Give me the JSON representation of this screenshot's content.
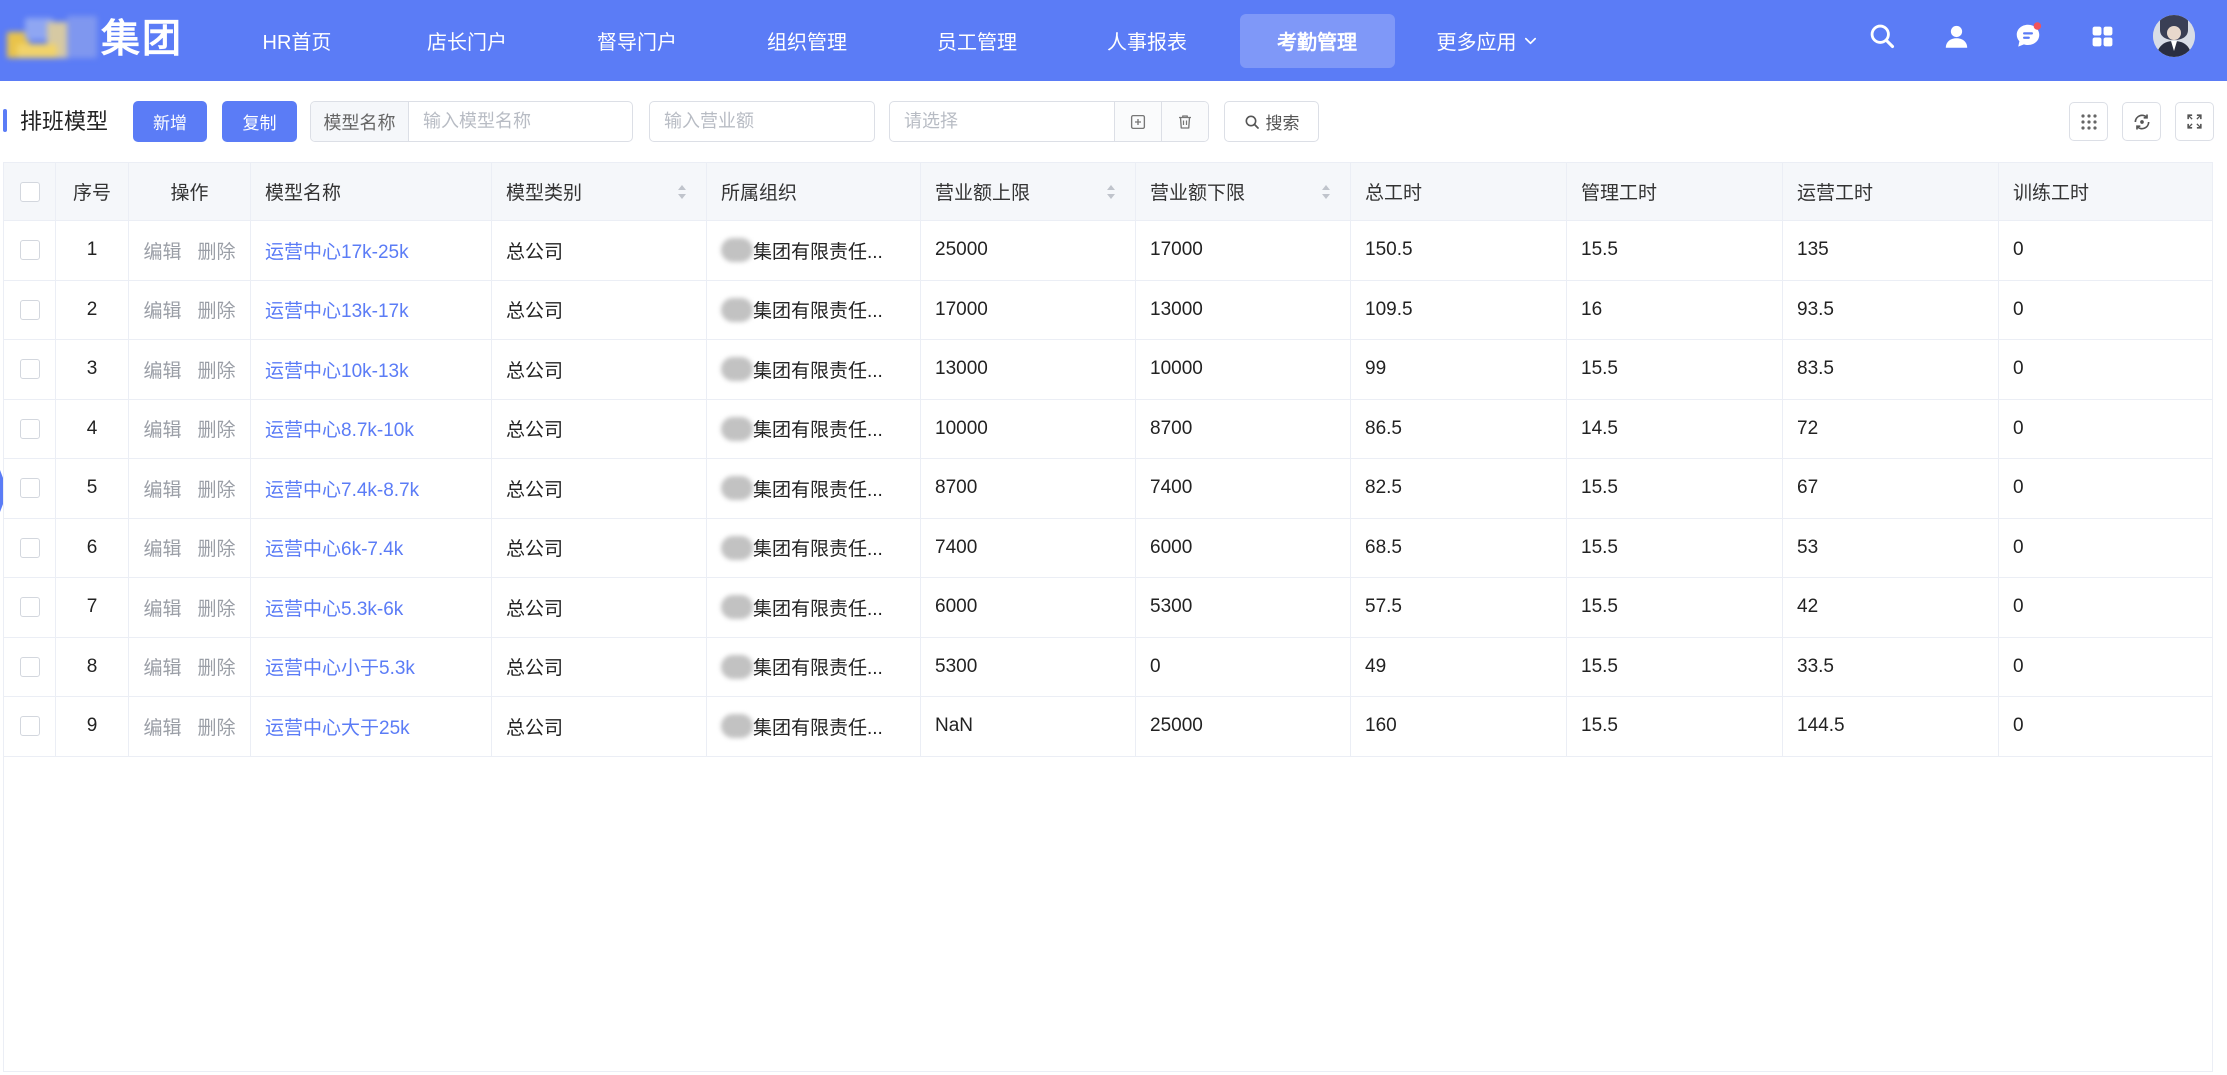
{
  "colors": {
    "primary": "#5b7cf6",
    "link": "#5b7cf6",
    "notification_dot": "#f2545b"
  },
  "brand": {
    "logo_text": "集团"
  },
  "nav": {
    "items": [
      {
        "label": "HR首页",
        "active": false
      },
      {
        "label": "店长门户",
        "active": false
      },
      {
        "label": "督导门户",
        "active": false
      },
      {
        "label": "组织管理",
        "active": false
      },
      {
        "label": "员工管理",
        "active": false
      },
      {
        "label": "人事报表",
        "active": false
      },
      {
        "label": "考勤管理",
        "active": true
      },
      {
        "label": "更多应用",
        "active": false,
        "icon": "chevron-down-icon"
      }
    ],
    "right_icons": [
      "search-icon",
      "user-icon",
      "message-icon",
      "apps-grid-icon",
      "user-avatar"
    ],
    "has_unread_messages": true
  },
  "toolbar": {
    "title": "排班模型",
    "add_label": "新增",
    "copy_label": "复制",
    "model_name": {
      "label": "模型名称",
      "placeholder": "输入模型名称"
    },
    "revenue": {
      "placeholder": "输入营业额"
    },
    "selector": {
      "placeholder": "请选择",
      "icons": [
        "plus-square-icon",
        "trash-icon"
      ]
    },
    "search_label": "搜索",
    "right_icons": [
      "column-settings-icon",
      "refresh-icon",
      "fullscreen-icon"
    ]
  },
  "table": {
    "columns": [
      {
        "label": "序号",
        "sortable": false
      },
      {
        "label": "操作",
        "sortable": false
      },
      {
        "label": "模型名称",
        "sortable": false
      },
      {
        "label": "模型类别",
        "sortable": true
      },
      {
        "label": "所属组织",
        "sortable": false
      },
      {
        "label": "营业额上限",
        "sortable": true
      },
      {
        "label": "营业额下限",
        "sortable": true
      },
      {
        "label": "总工时",
        "sortable": false
      },
      {
        "label": "管理工时",
        "sortable": false
      },
      {
        "label": "运营工时",
        "sortable": false
      },
      {
        "label": "训练工时",
        "sortable": false
      }
    ],
    "actions": {
      "edit": "编辑",
      "delete": "删除"
    },
    "rows": [
      {
        "index": 1,
        "name": "运营中心17k-25k",
        "category": "总公司",
        "org": "集团有限责任...",
        "revenue_max": 25000,
        "revenue_min": 17000,
        "total_hours": 150.5,
        "management_hours": 15.5,
        "operation_hours": 135,
        "training_hours": 0
      },
      {
        "index": 2,
        "name": "运营中心13k-17k",
        "category": "总公司",
        "org": "集团有限责任...",
        "revenue_max": 17000,
        "revenue_min": 13000,
        "total_hours": 109.5,
        "management_hours": 16,
        "operation_hours": 93.5,
        "training_hours": 0
      },
      {
        "index": 3,
        "name": "运营中心10k-13k",
        "category": "总公司",
        "org": "集团有限责任...",
        "revenue_max": 13000,
        "revenue_min": 10000,
        "total_hours": 99,
        "management_hours": 15.5,
        "operation_hours": 83.5,
        "training_hours": 0
      },
      {
        "index": 4,
        "name": "运营中心8.7k-10k",
        "category": "总公司",
        "org": "集团有限责任...",
        "revenue_max": 10000,
        "revenue_min": 8700,
        "total_hours": 86.5,
        "management_hours": 14.5,
        "operation_hours": 72,
        "training_hours": 0
      },
      {
        "index": 5,
        "name": "运营中心7.4k-8.7k",
        "category": "总公司",
        "org": "集团有限责任...",
        "revenue_max": 8700,
        "revenue_min": 7400,
        "total_hours": 82.5,
        "management_hours": 15.5,
        "operation_hours": 67,
        "training_hours": 0
      },
      {
        "index": 6,
        "name": "运营中心6k-7.4k",
        "category": "总公司",
        "org": "集团有限责任...",
        "revenue_max": 7400,
        "revenue_min": 6000,
        "total_hours": 68.5,
        "management_hours": 15.5,
        "operation_hours": 53,
        "training_hours": 0
      },
      {
        "index": 7,
        "name": "运营中心5.3k-6k",
        "category": "总公司",
        "org": "集团有限责任...",
        "revenue_max": 6000,
        "revenue_min": 5300,
        "total_hours": 57.5,
        "management_hours": 15.5,
        "operation_hours": 42,
        "training_hours": 0
      },
      {
        "index": 8,
        "name": "运营中心小于5.3k",
        "category": "总公司",
        "org": "集团有限责任...",
        "revenue_max": 5300,
        "revenue_min": 0,
        "total_hours": 49,
        "management_hours": 15.5,
        "operation_hours": 33.5,
        "training_hours": 0
      },
      {
        "index": 9,
        "name": "运营中心大于25k",
        "category": "总公司",
        "org": "集团有限责任...",
        "revenue_max": "NaN",
        "revenue_min": 25000,
        "total_hours": 160,
        "management_hours": 15.5,
        "operation_hours": 144.5,
        "training_hours": 0
      }
    ]
  }
}
